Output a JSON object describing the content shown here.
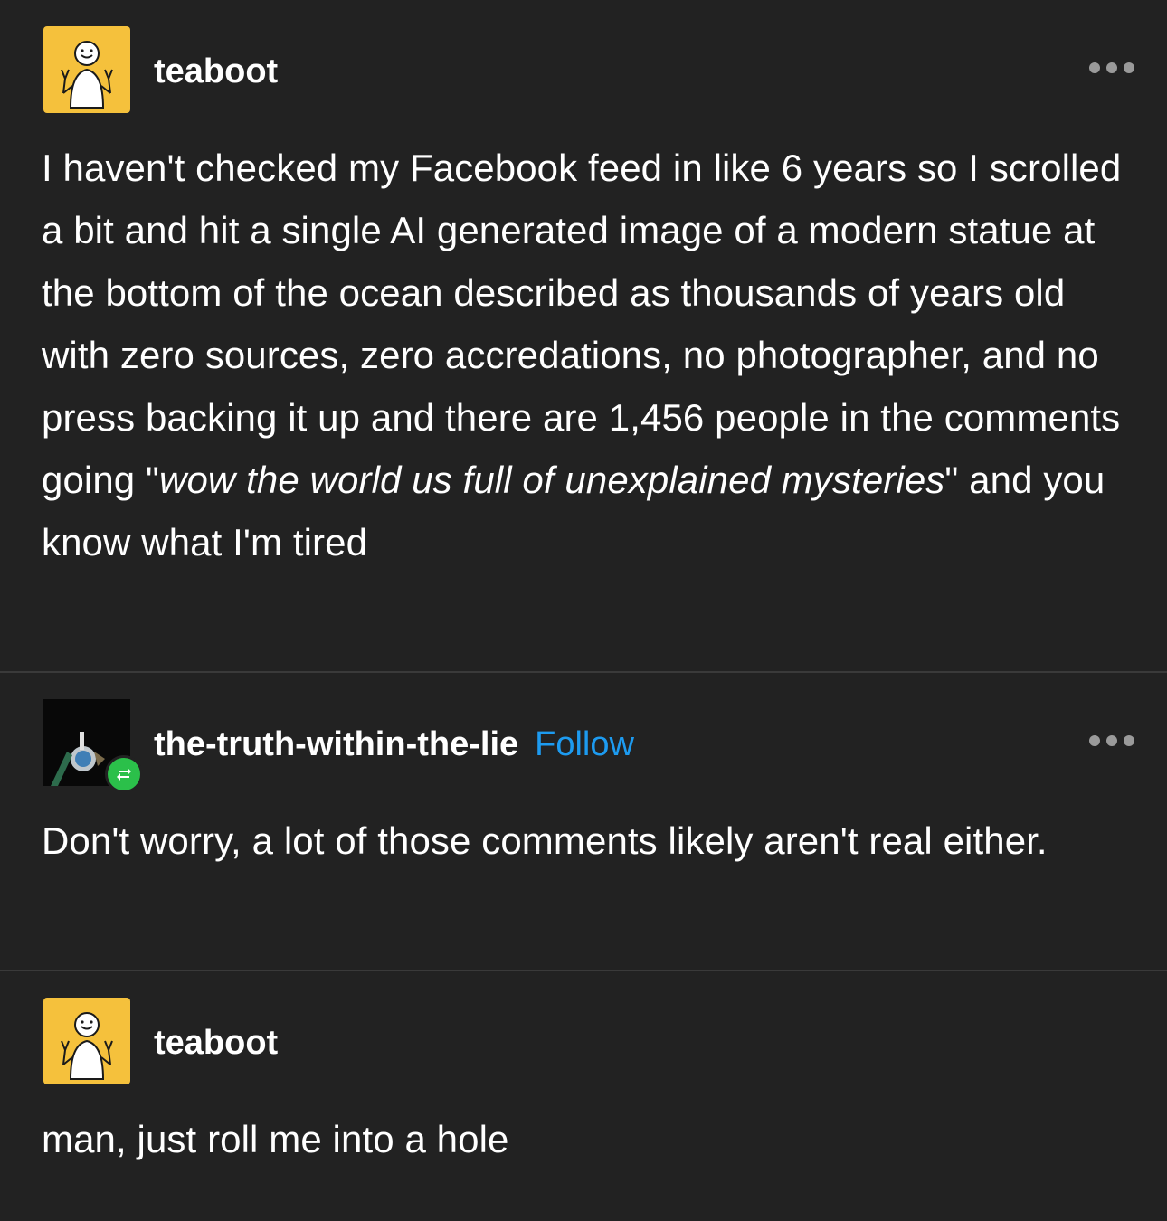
{
  "posts": [
    {
      "username": "teaboot",
      "body_parts": [
        "I haven't checked my Facebook feed in like 6 years so I scrolled a bit and hit a single AI generated image of a modern statue at the bottom of the ocean described as thousands of years old with zero sources, zero accredations, no photographer, and no press backing it up and there are 1,456 people in the comments going \"",
        "wow the world us full of unexplained mysteries",
        "\" and you know what I'm tired"
      ]
    },
    {
      "username": "the-truth-within-the-lie",
      "follow_label": "Follow",
      "body": "Don't worry, a lot of those comments likely aren't real either."
    },
    {
      "username": "teaboot",
      "body": "man, just roll me into a hole"
    }
  ],
  "colors": {
    "background": "#222222",
    "text": "#ffffff",
    "follow": "#1d9bf0",
    "avatar_yellow": "#f5c13c",
    "reblog_green": "#2bc04a",
    "divider": "#3a3a3a"
  },
  "icons": {
    "more": "more-options-icon",
    "reblog": "reblog-icon"
  }
}
